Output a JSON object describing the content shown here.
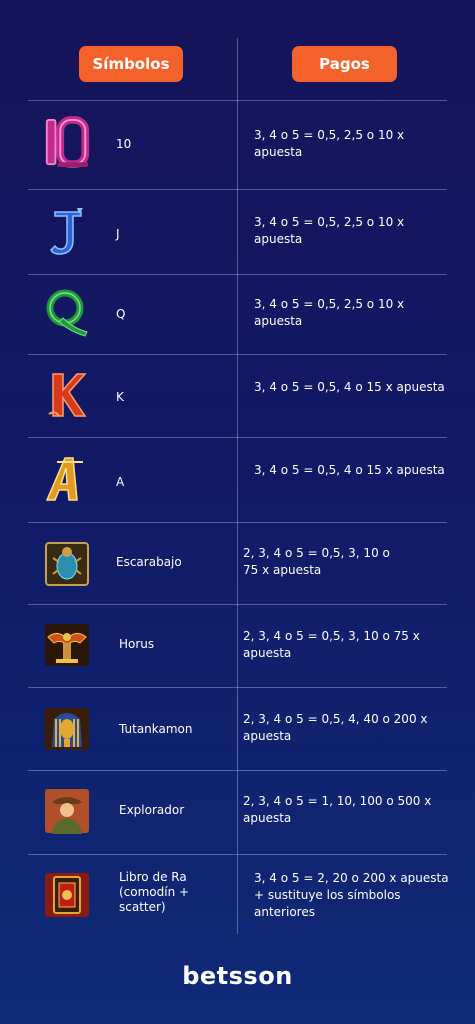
{
  "header": {
    "symbols_label": "Símbolos",
    "payouts_label": "Pagos"
  },
  "rows": [
    {
      "icon": "ten-symbol-icon",
      "symbol": "10",
      "payout": "3, 4 o 5 = 0,5, 2,5 o 10 x apuesta"
    },
    {
      "icon": "j-symbol-icon",
      "symbol": "J",
      "payout": "3, 4 o 5 = 0,5, 2,5 o 10 x apuesta"
    },
    {
      "icon": "q-symbol-icon",
      "symbol": "Q",
      "payout": "3, 4 o 5 = 0,5, 2,5 o 10 x apuesta"
    },
    {
      "icon": "k-symbol-icon",
      "symbol": "K",
      "payout": "3, 4 o 5 = 0,5, 4 o 15 x apuesta"
    },
    {
      "icon": "a-symbol-icon",
      "symbol": "A",
      "payout": "3, 4 o 5 = 0,5, 4 o 15 x apuesta"
    },
    {
      "icon": "scarab-icon",
      "symbol": "Escarabajo",
      "payout": "2, 3, 4 o 5 = 0,5, 3, 10 o 75 x apuesta"
    },
    {
      "icon": "horus-icon",
      "symbol": "Horus",
      "payout": "2, 3, 4 o 5 = 0,5, 3, 10 o 75 x apuesta"
    },
    {
      "icon": "tutankamon-mask-icon",
      "symbol": "Tutankamon",
      "payout": "2, 3, 4 o 5 = 0,5, 4, 40 o 200 x apuesta"
    },
    {
      "icon": "explorer-portrait-icon",
      "symbol": "Explorador",
      "payout": "2, 3, 4 o 5 = 1, 10, 100 o 500 x apuesta"
    },
    {
      "icon": "book-of-ra-icon",
      "symbol": "Libro de Ra (comodín + scatter)",
      "payout": "3, 4 o 5 = 2, 20 o 200 x apuesta + sustituye los símbolos anteriores"
    }
  ],
  "footer": {
    "brand": "betsson"
  }
}
